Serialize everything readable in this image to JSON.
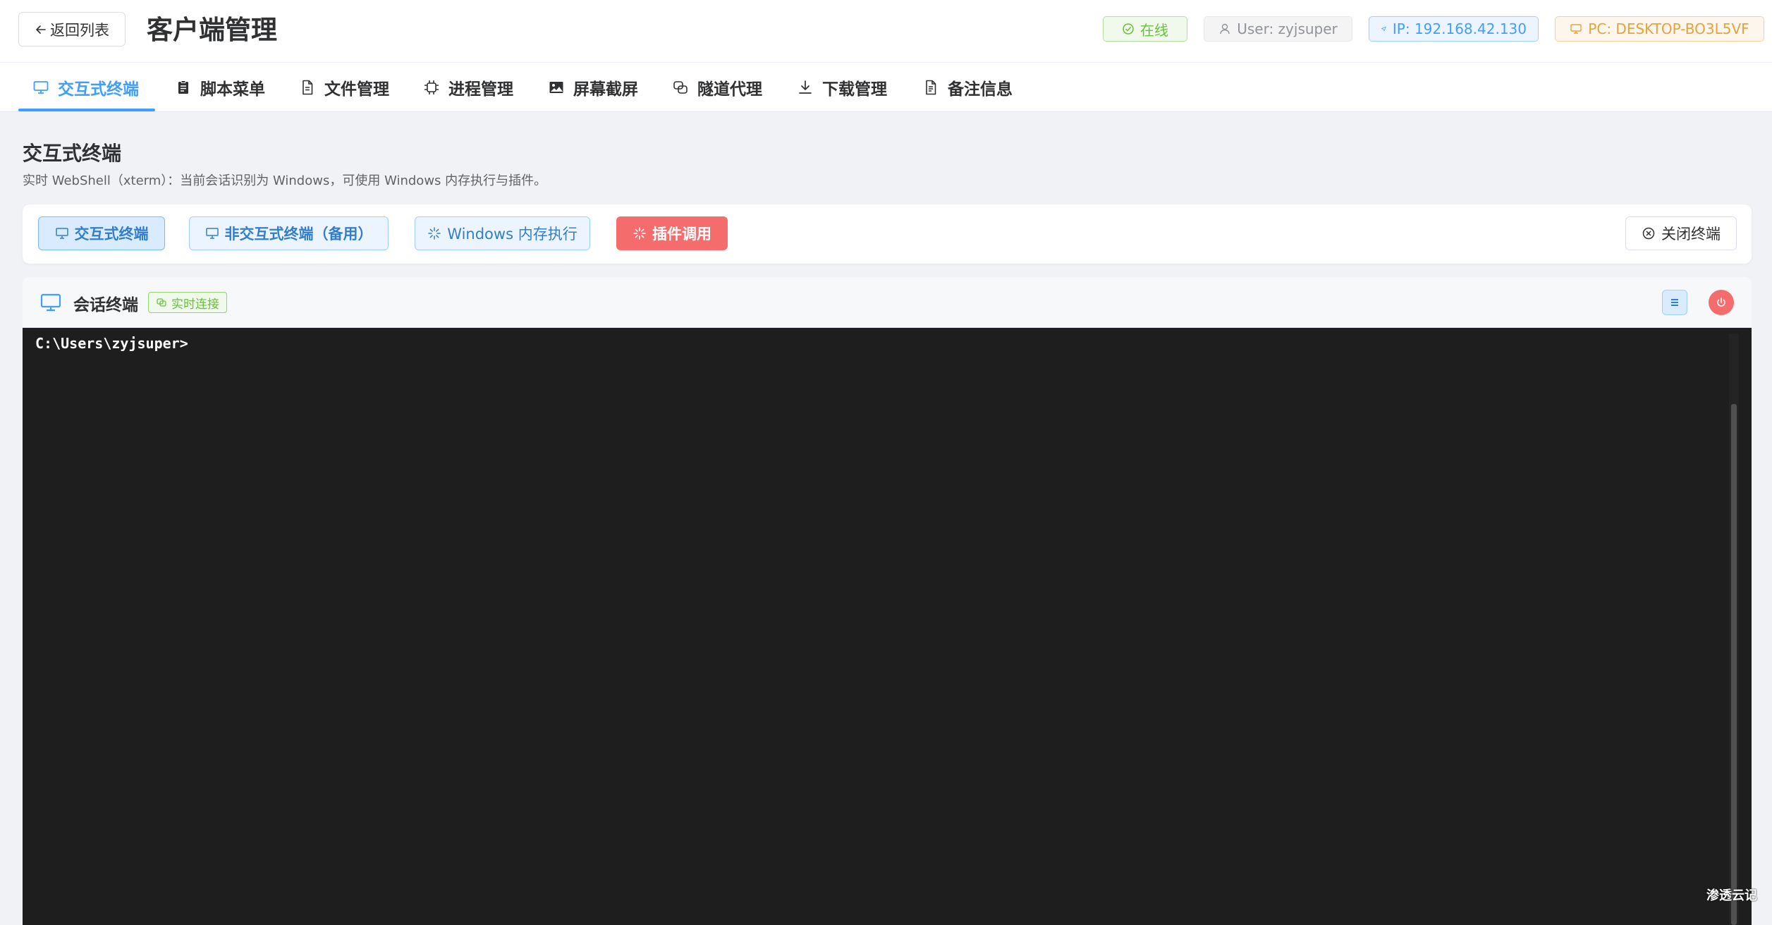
{
  "header": {
    "back_label": "返回列表",
    "title": "客户端管理",
    "status_online": "在线",
    "user": "User: zyjsuper",
    "ip": "IP: 192.168.42.130",
    "pc": "PC: DESKTOP-BO3L5VF"
  },
  "tabs": [
    {
      "label": "交互式终端",
      "icon": "monitor-icon",
      "active": true
    },
    {
      "label": "脚本菜单",
      "icon": "clipboard-icon",
      "active": false
    },
    {
      "label": "文件管理",
      "icon": "document-icon",
      "active": false
    },
    {
      "label": "进程管理",
      "icon": "cpu-icon",
      "active": false
    },
    {
      "label": "屏幕截屏",
      "icon": "picture-icon",
      "active": false
    },
    {
      "label": "隧道代理",
      "icon": "link-icon",
      "active": false
    },
    {
      "label": "下载管理",
      "icon": "download-icon",
      "active": false
    },
    {
      "label": "备注信息",
      "icon": "note-icon",
      "active": false
    }
  ],
  "section": {
    "title": "交互式终端",
    "description": "实时 WebShell（xterm）：当前会话识别为 Windows，可使用 Windows 内存执行与插件。"
  },
  "toolbar": {
    "interactive_label": "交互式终端",
    "noninteractive_label": "非交互式终端（备用）",
    "memexec_label": "Windows 内存执行",
    "plugin_label": "插件调用",
    "close_label": "关闭终端"
  },
  "terminal": {
    "title": "会话终端",
    "live_tag": "实时连接",
    "prompt": "C:\\Users\\zyjsuper>"
  },
  "watermark": "渗透云记",
  "colors": {
    "accent": "#409eff",
    "success": "#67c23a",
    "warning": "#e6a23c",
    "danger": "#f56c6c",
    "terminal_bg": "#1e1e1e"
  }
}
